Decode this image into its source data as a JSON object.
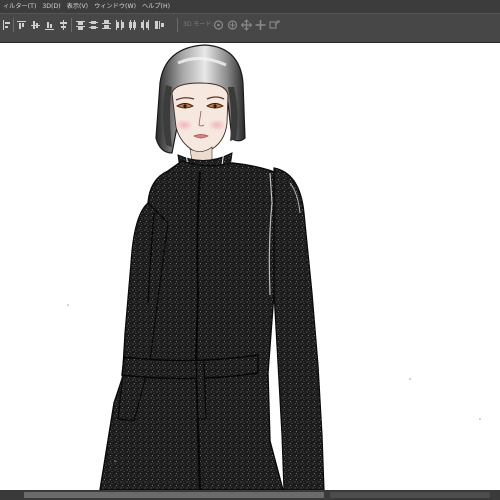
{
  "menubar": {
    "items": [
      "ィルター(T)",
      "3D(D)",
      "表示(V)",
      "ウィンドウ(W)",
      "ヘルプ(H)"
    ]
  },
  "optionsbar": {
    "mode_3d_label": "3D モード:",
    "align_icons": [
      "align-left-edges-icon",
      "align-horizontal-centers-icon",
      "align-right-edges-icon",
      "align-top-edges-icon",
      "align-vertical-centers-icon",
      "align-bottom-edges-icon"
    ],
    "distribute_icons": [
      "distribute-top-icon",
      "distribute-vcenter-icon",
      "distribute-bottom-icon",
      "distribute-left-icon",
      "distribute-hcenter-icon",
      "distribute-right-icon"
    ],
    "mode3d_icons": [
      "3d-rotate-icon",
      "3d-roll-icon",
      "3d-pan-icon",
      "3d-slide-icon",
      "3d-scale-icon"
    ]
  },
  "canvas": {
    "background": "#ffffff",
    "artwork": "fashion-illustration-figure"
  },
  "colors": {
    "menubar_bg": "#3c3c3c",
    "options_bg": "#474747",
    "coat": "#1c1c1c",
    "skin": "#f6e6dc",
    "hair": "#9a9a9a"
  }
}
